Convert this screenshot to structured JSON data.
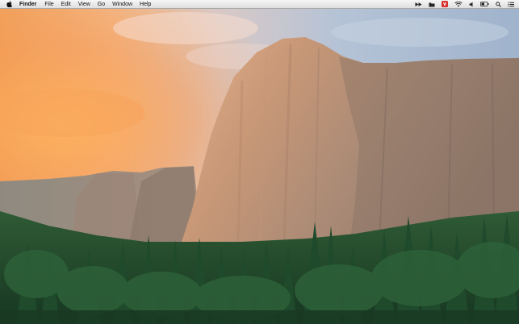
{
  "menubar": {
    "app_name": "Finder",
    "menus": [
      "File",
      "Edit",
      "View",
      "Go",
      "Window",
      "Help"
    ],
    "status_icons": [
      "airplay-icon",
      "folder-icon",
      "red-app-icon",
      "wifi-icon",
      "volume-icon",
      "battery-icon",
      "spotlight-icon",
      "notification-list-icon"
    ]
  },
  "desktop": {
    "wallpaper": "yosemite-el-capitan-wallpaper"
  },
  "colors": {
    "menubar_bg": "#e8e8e8",
    "status_red": "#d8302c"
  }
}
